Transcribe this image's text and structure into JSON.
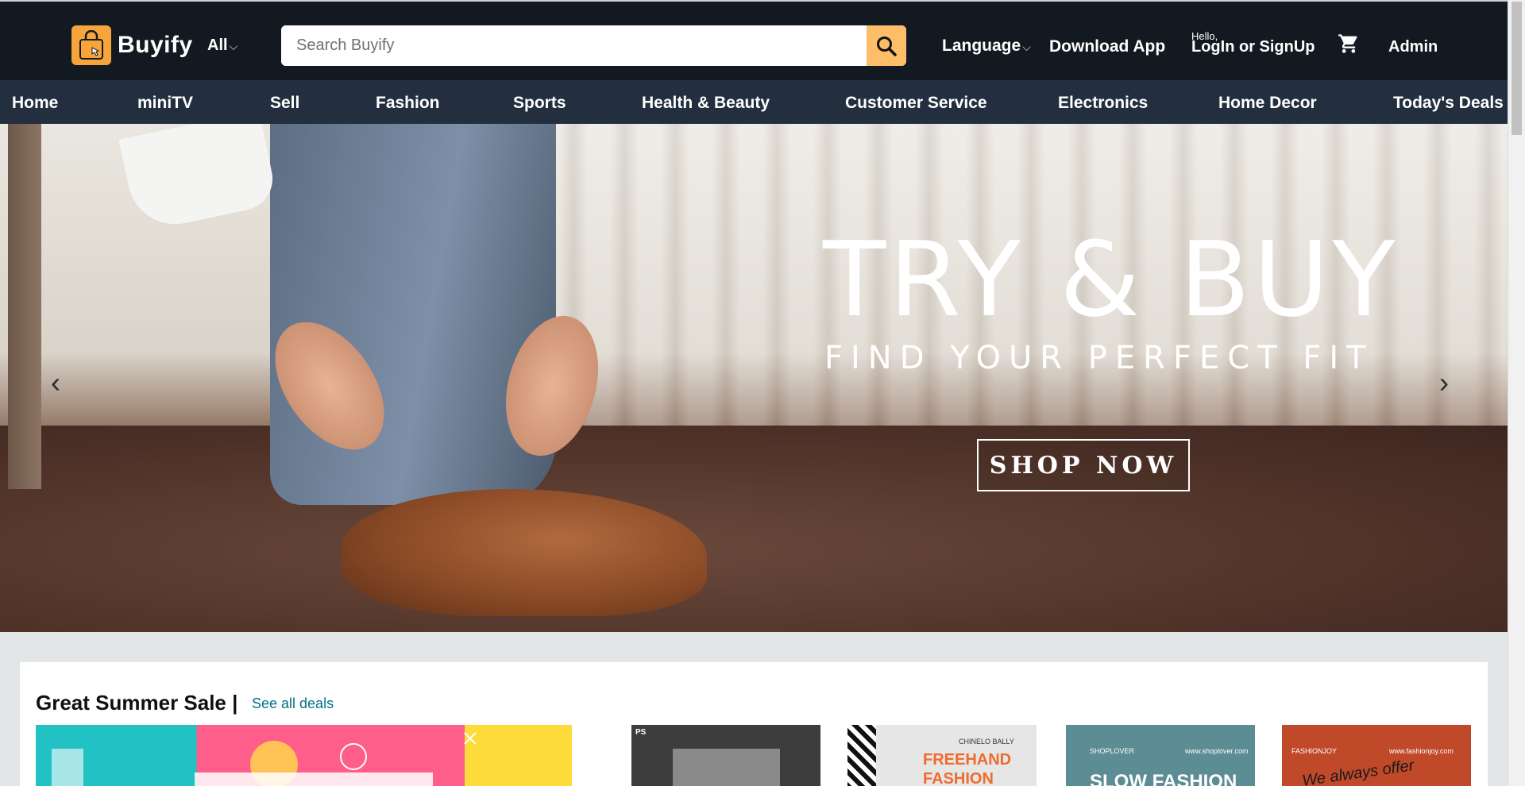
{
  "header": {
    "brand": "Buyify",
    "category_selector": "All",
    "search_placeholder": "Search Buyify",
    "language_label": "Language",
    "download_app_label": "Download App",
    "greeting": "Hello,",
    "login_label": "LogIn or SignUp",
    "admin_label": "Admin"
  },
  "subnav": {
    "items": [
      "Home",
      "miniTV",
      "Sell",
      "Fashion",
      "Sports",
      "Health & Beauty",
      "Customer Service",
      "Electronics",
      "Home Decor",
      "Today's Deals"
    ]
  },
  "hero": {
    "title": "TRY & BUY",
    "subtitle": "FIND YOUR PERFECT FIT",
    "cta": "SHOP NOW"
  },
  "deals": {
    "title": "Great Summer Sale |",
    "see_all": "See all deals",
    "cards": [
      {
        "label": ""
      },
      {
        "label": "PS"
      },
      {
        "brand": "CHINELO BALLY",
        "label": "FREEHAND FASHION"
      },
      {
        "brand": "SHOPLOVER",
        "site": "www.shoplover.com",
        "label": "SLOW FASHION"
      },
      {
        "brand": "FASHIONJOY",
        "site": "www.fashionjoy.com",
        "label": "We always offer"
      }
    ]
  },
  "icons": [
    "shopping-bag-icon",
    "chevron-down-icon",
    "search-icon",
    "cart-icon",
    "chevron-left-icon",
    "chevron-right-icon"
  ],
  "colors": {
    "topbar": "#131921",
    "subnav": "#232f3e",
    "accent": "#febd69",
    "link": "#007185"
  }
}
